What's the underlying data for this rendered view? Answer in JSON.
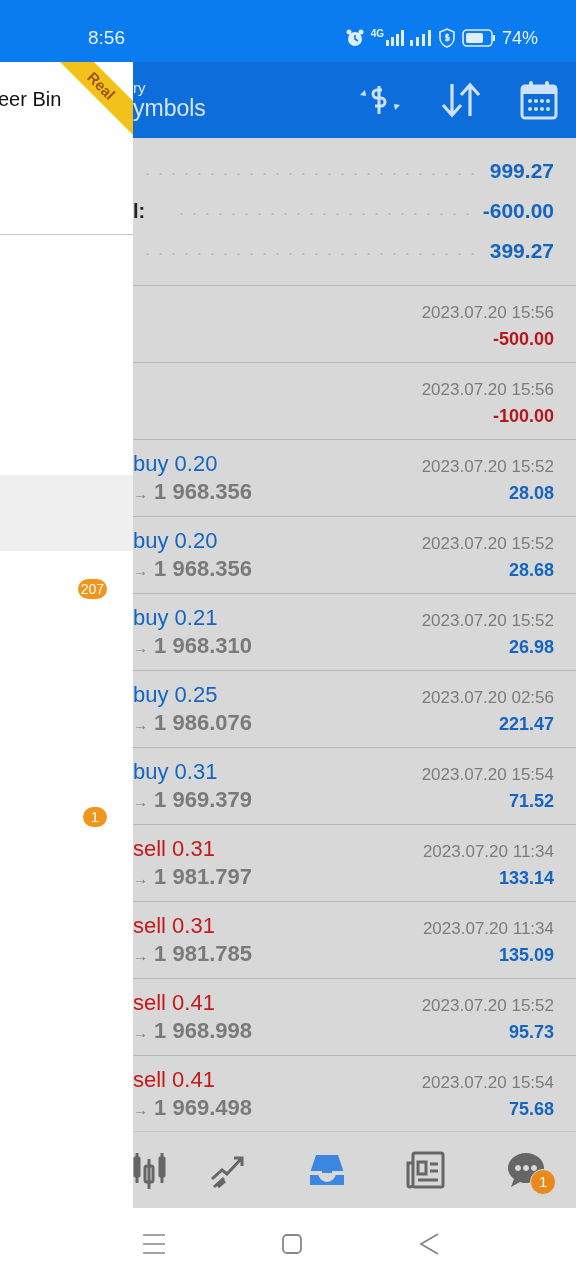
{
  "status_bar": {
    "time": "8:56",
    "network": "4G",
    "battery": "74%"
  },
  "drawer": {
    "account_name": "eer Bin",
    "ribbon": "Real",
    "items": [
      {
        "selected": true
      },
      {
        "selected": false,
        "badge": "207"
      },
      {
        "selected": false,
        "badge": "1"
      }
    ]
  },
  "header": {
    "title_line1": "ry",
    "title_line2": "ymbols"
  },
  "summary": [
    {
      "value": "999.27"
    },
    {
      "label": "l:",
      "value": "-600.00"
    },
    {
      "value": "399.27"
    }
  ],
  "deals": [
    {
      "kind": "balance",
      "time": "2023.07.20 15:56",
      "amount": "-500.00",
      "negative": true
    },
    {
      "kind": "balance",
      "time": "2023.07.20 15:56",
      "amount": "-100.00",
      "negative": true
    },
    {
      "kind": "buy",
      "title": "buy 0.20",
      "direction": "→",
      "price": "1 968.356",
      "time": "2023.07.20 15:52",
      "amount": "28.08",
      "negative": false
    },
    {
      "kind": "buy",
      "title": "buy 0.20",
      "direction": "→",
      "price": "1 968.356",
      "time": "2023.07.20 15:52",
      "amount": "28.68",
      "negative": false
    },
    {
      "kind": "buy",
      "title": "buy 0.21",
      "direction": "→",
      "price": "1 968.310",
      "time": "2023.07.20 15:52",
      "amount": "26.98",
      "negative": false
    },
    {
      "kind": "buy",
      "title": "buy 0.25",
      "direction": "→",
      "price": "1 986.076",
      "time": "2023.07.20 02:56",
      "amount": "221.47",
      "negative": false
    },
    {
      "kind": "buy",
      "title": "buy 0.31",
      "direction": "→",
      "price": "1 969.379",
      "time": "2023.07.20 15:54",
      "amount": "71.52",
      "negative": false
    },
    {
      "kind": "sell",
      "title": "sell 0.31",
      "direction": "→",
      "price": "1 981.797",
      "time": "2023.07.20 11:34",
      "amount": "133.14",
      "negative": false
    },
    {
      "kind": "sell",
      "title": "sell 0.31",
      "direction": "→",
      "price": "1 981.785",
      "time": "2023.07.20 11:34",
      "amount": "135.09",
      "negative": false
    },
    {
      "kind": "sell",
      "title": "sell 0.41",
      "direction": "→",
      "price": "1 968.998",
      "time": "2023.07.20 15:52",
      "amount": "95.73",
      "negative": false
    },
    {
      "kind": "sell",
      "title": "sell 0.41",
      "direction": "→",
      "price": "1 969.498",
      "time": "2023.07.20 15:54",
      "amount": "75.68",
      "negative": false
    }
  ],
  "bottom_tabs": [
    {
      "kind": "chart",
      "selected": false
    },
    {
      "kind": "trade",
      "selected": false
    },
    {
      "kind": "history",
      "selected": true
    },
    {
      "kind": "news",
      "selected": false
    },
    {
      "kind": "messages",
      "selected": false,
      "badge": "1"
    }
  ]
}
